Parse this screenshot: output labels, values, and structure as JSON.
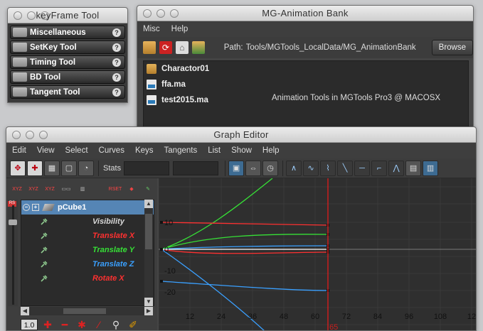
{
  "keyframe_window": {
    "title": "keyFrame Tool",
    "buttons": [
      "Miscellaneous",
      "SetKey Tool",
      "Timing Tool",
      "BD Tool",
      "Tangent Tool"
    ],
    "help_glyph": "?"
  },
  "bank_window": {
    "title": "MG-Animation Bank",
    "menu": [
      "Misc",
      "Help"
    ],
    "path_label": "Path:",
    "path_value": "Tools/MGTools_LocalData/MG_AnimationBank",
    "browse_label": "Browse",
    "files": [
      {
        "name": "Charactor01",
        "icon": "folder-icon"
      },
      {
        "name": "ffa.ma",
        "icon": "maya-file-icon"
      },
      {
        "name": "test2015.ma",
        "icon": "maya-file-icon"
      }
    ],
    "info_text": "Animation Tools in MGTools Pro3 @ MACOSX"
  },
  "graph_editor": {
    "title": "Graph Editor",
    "menu": [
      "Edit",
      "View",
      "Select",
      "Curves",
      "Keys",
      "Tangents",
      "List",
      "Show",
      "Help"
    ],
    "stats_label": "Stats",
    "outliner": {
      "object": "pCube1",
      "attributes": [
        {
          "name": "Visibility",
          "color": "#d8d8d8"
        },
        {
          "name": "Translate X",
          "color": "#ff3030"
        },
        {
          "name": "Translate Y",
          "color": "#36e036"
        },
        {
          "name": "Translate Z",
          "color": "#3aa0ff"
        },
        {
          "name": "Rotate X",
          "color": "#ff3030"
        }
      ],
      "zoom_value": "1.0",
      "mini_labels": [
        "XYZ",
        "XYZ",
        "XYZ",
        "RSET"
      ]
    },
    "graph": {
      "y_ticks": [
        "10",
        "0",
        "-10",
        "-20"
      ],
      "x_ticks": [
        "12",
        "24",
        "36",
        "48",
        "60",
        "72",
        "84",
        "96",
        "108",
        "12"
      ],
      "current_frame": "65",
      "colors": {
        "background": "#2f2f2f",
        "grid": "#3a3a3a",
        "time_line": "#c81e1e"
      }
    }
  }
}
